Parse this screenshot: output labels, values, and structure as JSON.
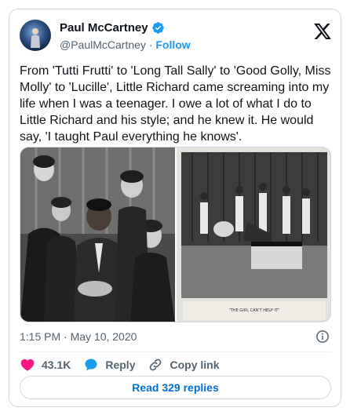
{
  "author": {
    "display_name": "Paul McCartney",
    "handle": "@PaulMcCartney",
    "separator": "·",
    "follow_label": "Follow",
    "verified": true
  },
  "tweet": {
    "text": "From 'Tutti Frutti' to 'Long Tall Sally' to 'Good Golly, Miss Molly' to 'Lucille', Little Richard came screaming into my life when I was a teenager. I owe a lot of what I do to Little Richard and his style; and he knew it. He would say, 'I taught Paul everything he knows'.",
    "timestamp": "1:15 PM · May 10, 2020"
  },
  "media": {
    "caption_strip": "\"THE GIRL CAN'T HELP IT\""
  },
  "actions": {
    "like_count": "43.1K",
    "reply_label": "Reply",
    "copy_link_label": "Copy link"
  },
  "footer": {
    "read_replies_label": "Read 329 replies"
  },
  "colors": {
    "accent": "#1d9bf0",
    "like_red": "#f91880",
    "text": "#0f1419",
    "muted": "#536471",
    "border": "#cfd9de"
  },
  "icons": [
    "verified-badge-icon",
    "x-logo-icon",
    "info-icon",
    "heart-icon",
    "reply-icon",
    "link-icon"
  ]
}
